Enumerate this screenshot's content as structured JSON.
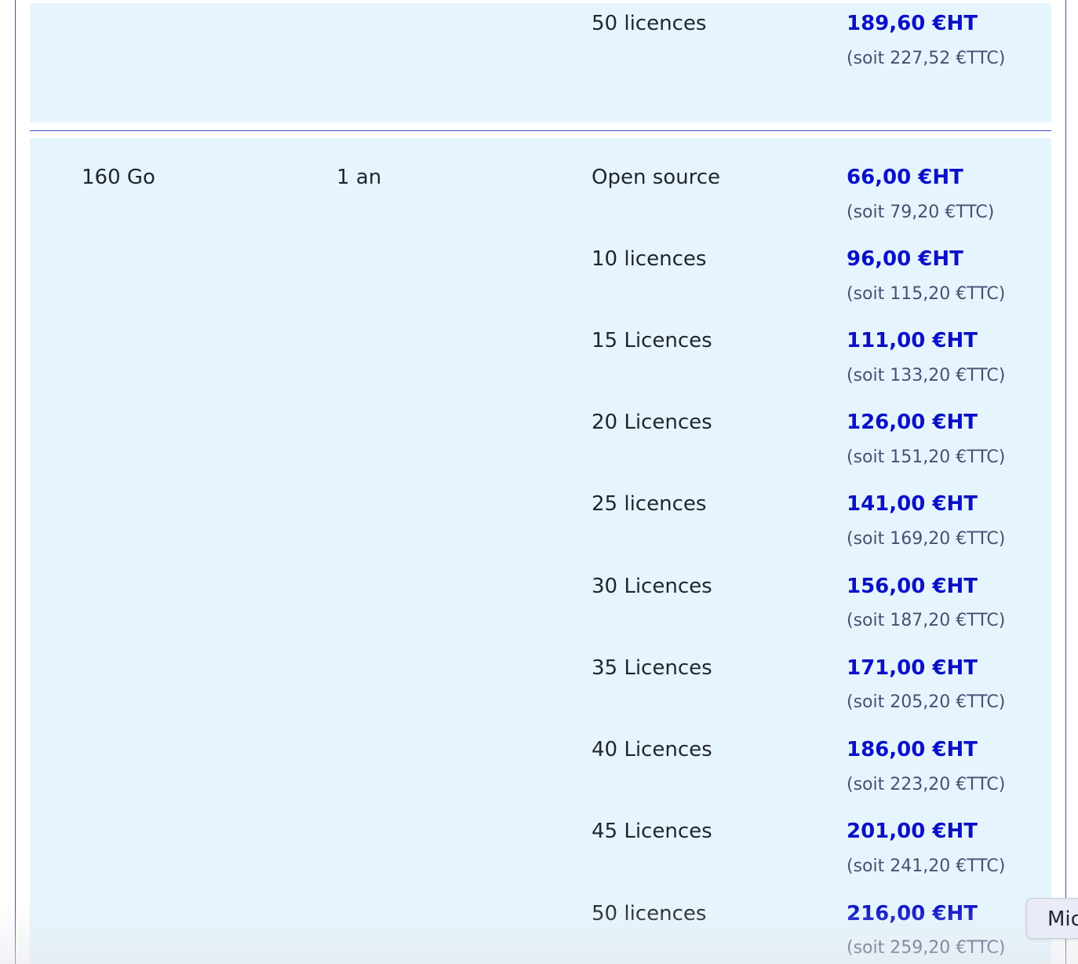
{
  "top_section": {
    "licence": "50 licences",
    "price_ht": "189,60 €HT",
    "price_ttc": "(soit 227,52 €TTC)"
  },
  "main_section": {
    "capacity": "160 Go",
    "duration": "1 an",
    "rows": [
      {
        "licence": "Open source",
        "price_ht": "66,00 €HT",
        "price_ttc": "(soit 79,20 €TTC)"
      },
      {
        "licence": "10 licences",
        "price_ht": "96,00 €HT",
        "price_ttc": "(soit 115,20 €TTC)"
      },
      {
        "licence": "15 Licences",
        "price_ht": "111,00 €HT",
        "price_ttc": "(soit 133,20 €TTC)"
      },
      {
        "licence": "20 Licences",
        "price_ht": "126,00 €HT",
        "price_ttc": "(soit 151,20 €TTC)"
      },
      {
        "licence": "25 licences",
        "price_ht": "141,00 €HT",
        "price_ttc": "(soit 169,20 €TTC)"
      },
      {
        "licence": "30 Licences",
        "price_ht": "156,00 €HT",
        "price_ttc": "(soit 187,20 €TTC)"
      },
      {
        "licence": "35 Licences",
        "price_ht": "171,00 €HT",
        "price_ttc": "(soit 205,20 €TTC)"
      },
      {
        "licence": "40 Licences",
        "price_ht": "186,00 €HT",
        "price_ttc": "(soit 223,20 €TTC)"
      },
      {
        "licence": "45 Licences",
        "price_ht": "201,00 €HT",
        "price_ttc": "(soit 241,20 €TTC)"
      },
      {
        "licence": "50 licences",
        "price_ht": "216,00 €HT",
        "price_ttc": "(soit 259,20 €TTC)"
      }
    ]
  },
  "floating_button": {
    "label": "Mic"
  },
  "colors": {
    "panel_bg": "#e6f5fd",
    "price_ht": "#0a10c8",
    "price_ttc": "#4a4f72",
    "frame_line": "#3b4bd1"
  }
}
